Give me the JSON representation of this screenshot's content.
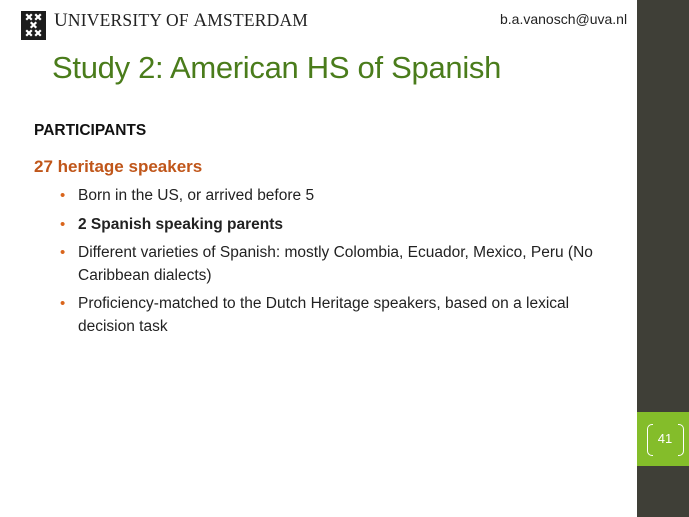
{
  "header": {
    "university_prefix": "U",
    "university_rest": "NIVERSITY OF ",
    "university_prefix2": "A",
    "university_rest2": "MSTERDAM",
    "email": "b.a.vanosch@uva.nl"
  },
  "slide": {
    "title": "Study 2: American HS of Spanish",
    "section_heading": "PARTICIPANTS",
    "subheading": "27 heritage speakers",
    "bullets": [
      {
        "text": "Born in the US, or arrived before 5",
        "bold": false
      },
      {
        "text": "2 Spanish speaking parents",
        "bold": true
      },
      {
        "text": "Different varieties of Spanish: mostly Colombia, Ecuador,  Mexico, Peru (No Caribbean dialects)",
        "bold": false
      },
      {
        "text": "Proficiency-matched to the Dutch Heritage speakers, based on a lexical decision task",
        "bold": false
      }
    ],
    "bullet_glyph": "•",
    "page_number": "41"
  },
  "colors": {
    "title": "#4a7c1b",
    "subheading": "#c0561a",
    "bullet": "#d9651c",
    "sidebar": "#3f3f37",
    "page_badge": "#84bd2a"
  },
  "icons": {
    "logo": "university-crest-icon"
  }
}
